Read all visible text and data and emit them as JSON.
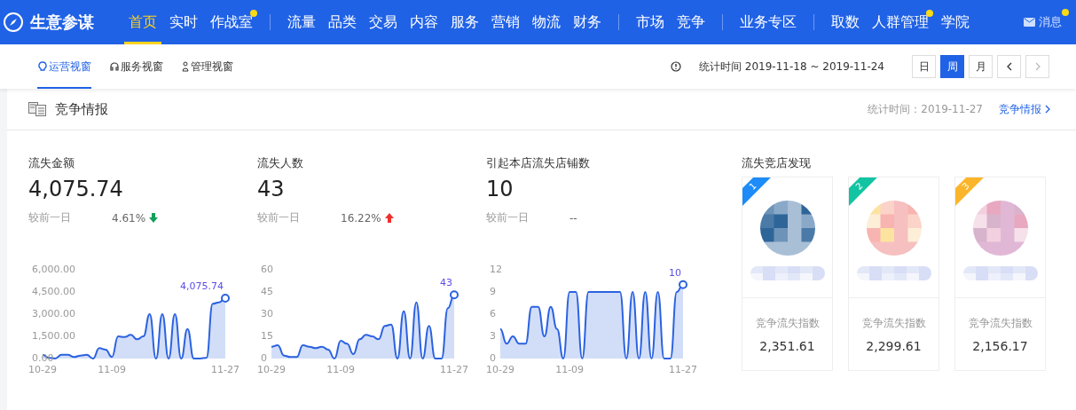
{
  "topbar": {
    "brand": "生意参谋",
    "groups": [
      {
        "items": [
          {
            "label": "首页",
            "selected": true,
            "dot": false
          },
          {
            "label": "实时",
            "selected": false,
            "dot": false
          },
          {
            "label": "作战室",
            "selected": false,
            "dot": true
          }
        ]
      },
      {
        "items": [
          {
            "label": "流量",
            "selected": false,
            "dot": false
          },
          {
            "label": "品类",
            "selected": false,
            "dot": false
          },
          {
            "label": "交易",
            "selected": false,
            "dot": false
          },
          {
            "label": "内容",
            "selected": false,
            "dot": false
          },
          {
            "label": "服务",
            "selected": false,
            "dot": false
          },
          {
            "label": "营销",
            "selected": false,
            "dot": false
          },
          {
            "label": "物流",
            "selected": false,
            "dot": false
          },
          {
            "label": "财务",
            "selected": false,
            "dot": false
          }
        ]
      },
      {
        "items": [
          {
            "label": "市场",
            "selected": false,
            "dot": false
          },
          {
            "label": "竞争",
            "selected": false,
            "dot": false
          }
        ]
      },
      {
        "items": [
          {
            "label": "业务专区",
            "selected": false,
            "dot": false
          }
        ]
      },
      {
        "items": [
          {
            "label": "取数",
            "selected": false,
            "dot": false
          },
          {
            "label": "人群管理",
            "selected": false,
            "dot": true
          },
          {
            "label": "学院",
            "selected": false,
            "dot": false
          }
        ]
      }
    ],
    "messages": {
      "label": "消息",
      "dot": true
    }
  },
  "subnav": {
    "tabs": [
      {
        "label": "运营视窗",
        "kind": "bulb",
        "selected": true
      },
      {
        "label": "服务视窗",
        "kind": "headset",
        "selected": false
      },
      {
        "label": "管理视窗",
        "kind": "person",
        "selected": false
      }
    ],
    "stat_time": "统计时间 2019-11-18 ~ 2019-11-24",
    "periods": [
      {
        "label": "日",
        "selected": false
      },
      {
        "label": "周",
        "selected": true
      },
      {
        "label": "月",
        "selected": false
      }
    ],
    "prev": {
      "disabled": false
    },
    "next": {
      "disabled": true
    }
  },
  "section": {
    "title": "竞争情报",
    "stat_time": "统计时间：2019-11-27",
    "link": "竞争情报"
  },
  "metrics": [
    {
      "title": "流失金额",
      "value": "4,075.74",
      "compare_label": "较前一日",
      "change": "4.61%",
      "rising": false,
      "chart_data": {
        "type": "area",
        "categories": [
          "10-29",
          null,
          null,
          null,
          null,
          null,
          null,
          null,
          null,
          null,
          null,
          "11-09",
          null,
          null,
          null,
          null,
          null,
          null,
          null,
          null,
          null,
          null,
          null,
          null,
          null,
          null,
          null,
          null,
          null,
          "11-27"
        ],
        "series": [
          {
            "color": "#2b62e0",
            "values": [
              250,
              50,
              0,
              250,
              250,
              100,
              200,
              250,
              0,
              700,
              600,
              100,
              1500,
              1450,
              1600,
              1300,
              1500,
              3000,
              0,
              3000,
              0,
              3000,
              0,
              2000,
              0,
              0,
              50,
              3700,
              3800,
              4076
            ]
          }
        ],
        "ylim": [
          0,
          6000
        ],
        "yticks": [
          {
            "value": 0,
            "label": "0.00"
          },
          {
            "value": 1500,
            "label": "1,500.00"
          },
          {
            "value": 3000,
            "label": "3,000.00"
          },
          {
            "value": 4500,
            "label": "4,500.00"
          },
          {
            "value": 6000,
            "label": "6,000.00"
          }
        ],
        "annotations": [
          {
            "text": "4,075.74"
          }
        ]
      }
    },
    {
      "title": "流失人数",
      "value": "43",
      "compare_label": "较前一日",
      "change": "16.22%",
      "rising": true,
      "chart_data": {
        "type": "area",
        "categories": [
          "10-29",
          null,
          null,
          null,
          null,
          null,
          null,
          null,
          null,
          null,
          null,
          "11-09",
          null,
          null,
          null,
          null,
          null,
          null,
          null,
          null,
          null,
          null,
          null,
          null,
          null,
          null,
          null,
          null,
          null,
          "11-27"
        ],
        "series": [
          {
            "color": "#2b62e0",
            "values": [
              8,
              9,
              2,
              1,
              1,
              9,
              8,
              7,
              8,
              6,
              0,
              12,
              10,
              3,
              13,
              16,
              15,
              13,
              22,
              23,
              0,
              32,
              0,
              38,
              0,
              22,
              0,
              0,
              34,
              43
            ]
          }
        ],
        "ylim": [
          0,
          60
        ],
        "yticks": [
          0,
          15,
          30,
          45,
          60
        ],
        "annotations": [
          {
            "text": "43"
          }
        ]
      }
    },
    {
      "title": "引起本店流失店铺数",
      "value": "10",
      "compare_label": "较前一日",
      "change": "--",
      "chart_data": {
        "type": "area",
        "categories": [
          "10-29",
          null,
          null,
          null,
          null,
          null,
          null,
          null,
          null,
          null,
          null,
          "11-09",
          null,
          null,
          null,
          null,
          null,
          null,
          null,
          null,
          null,
          null,
          null,
          null,
          null,
          null,
          null,
          null,
          null,
          "11-27"
        ],
        "series": [
          {
            "color": "#2b62e0",
            "values": [
              4,
              2,
              3,
              2,
              2,
              7,
              7,
              3,
              7,
              4,
              0,
              9,
              9,
              0,
              9,
              9,
              9,
              9,
              9,
              9,
              0,
              9,
              0,
              9,
              0,
              9,
              0,
              0,
              9,
              10
            ]
          }
        ],
        "ylim": [
          0,
          12
        ],
        "yticks": [
          0,
          3,
          6,
          9,
          12
        ],
        "annotations": [
          {
            "text": "10"
          }
        ]
      }
    }
  ],
  "competitors": {
    "title": "流失竞店发现",
    "shops": [
      {
        "rank": "1",
        "color": "#1d8cf8",
        "index_label": "竞争流失指数",
        "index": "2,351.61"
      },
      {
        "rank": "2",
        "color": "#13c4a3",
        "index_label": "竞争流失指数",
        "index": "2,299.61"
      },
      {
        "rank": "3",
        "color": "#fbb52b",
        "index_label": "竞争流失指数",
        "index": "2,156.17"
      }
    ]
  }
}
